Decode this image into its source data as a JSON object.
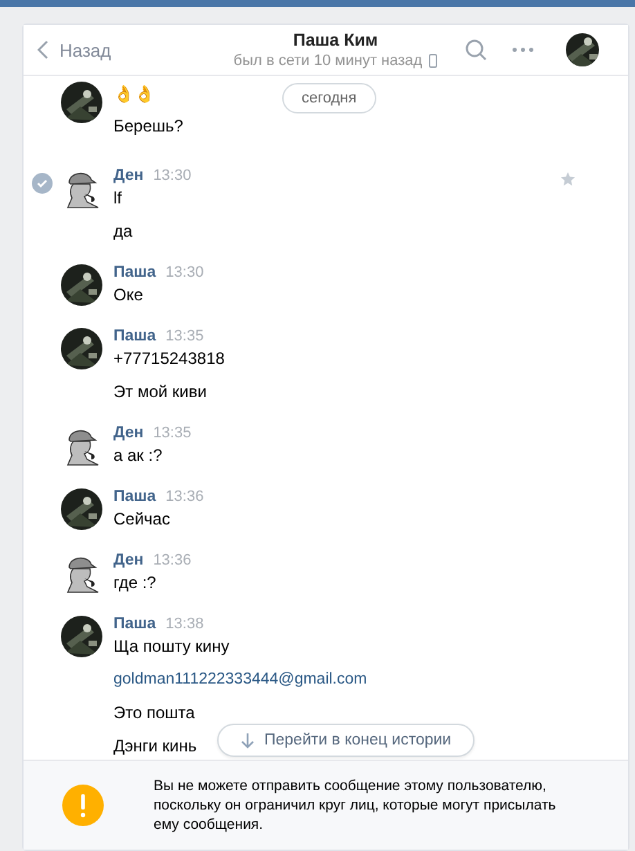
{
  "header": {
    "back": "Назад",
    "title": "Паша Ким",
    "status": "был в сети 10 минут назад"
  },
  "date_pill": "сегодня",
  "groups": [
    {
      "kind": "pasha",
      "selected": false,
      "starred": false,
      "messages": [
        {
          "kind": "text",
          "text": "👌👌"
        },
        {
          "kind": "text",
          "text": "Берешь?"
        }
      ]
    },
    {
      "kind": "den",
      "author": "Ден",
      "time": "13:30",
      "selected": true,
      "starred": true,
      "messages": [
        {
          "kind": "text",
          "text": "lf"
        },
        {
          "kind": "text",
          "text": "да"
        }
      ]
    },
    {
      "kind": "pasha",
      "author": "Паша",
      "time": "13:30",
      "selected": false,
      "starred": false,
      "messages": [
        {
          "kind": "text",
          "text": "Оке"
        }
      ]
    },
    {
      "kind": "pasha",
      "author": "Паша",
      "time": "13:35",
      "selected": false,
      "starred": false,
      "messages": [
        {
          "kind": "text",
          "text": "+77715243818"
        },
        {
          "kind": "text",
          "text": "Эт мой киви"
        }
      ]
    },
    {
      "kind": "den",
      "author": "Ден",
      "time": "13:35",
      "selected": false,
      "starred": false,
      "messages": [
        {
          "kind": "text",
          "text": "а ак :?"
        }
      ]
    },
    {
      "kind": "pasha",
      "author": "Паша",
      "time": "13:36",
      "selected": false,
      "starred": false,
      "messages": [
        {
          "kind": "text",
          "text": "Сейчас"
        }
      ]
    },
    {
      "kind": "den",
      "author": "Ден",
      "time": "13:36",
      "selected": false,
      "starred": false,
      "messages": [
        {
          "kind": "text",
          "text": "где :?"
        }
      ]
    },
    {
      "kind": "pasha",
      "author": "Паша",
      "time": "13:38",
      "selected": false,
      "starred": false,
      "messages": [
        {
          "kind": "text",
          "text": "Ща пошту кину"
        },
        {
          "kind": "link",
          "text": "goldman111222333444@gmail.com"
        },
        {
          "kind": "text",
          "text": "Это пошта"
        },
        {
          "kind": "text",
          "text": "Дэнги кинь"
        }
      ]
    }
  ],
  "jump_button": "Перейти в конец истории",
  "notice": "Вы не можете отправить сообщение этому пользователю, поскольку он ограничил круг лиц, которые могут присылать ему сообщения."
}
